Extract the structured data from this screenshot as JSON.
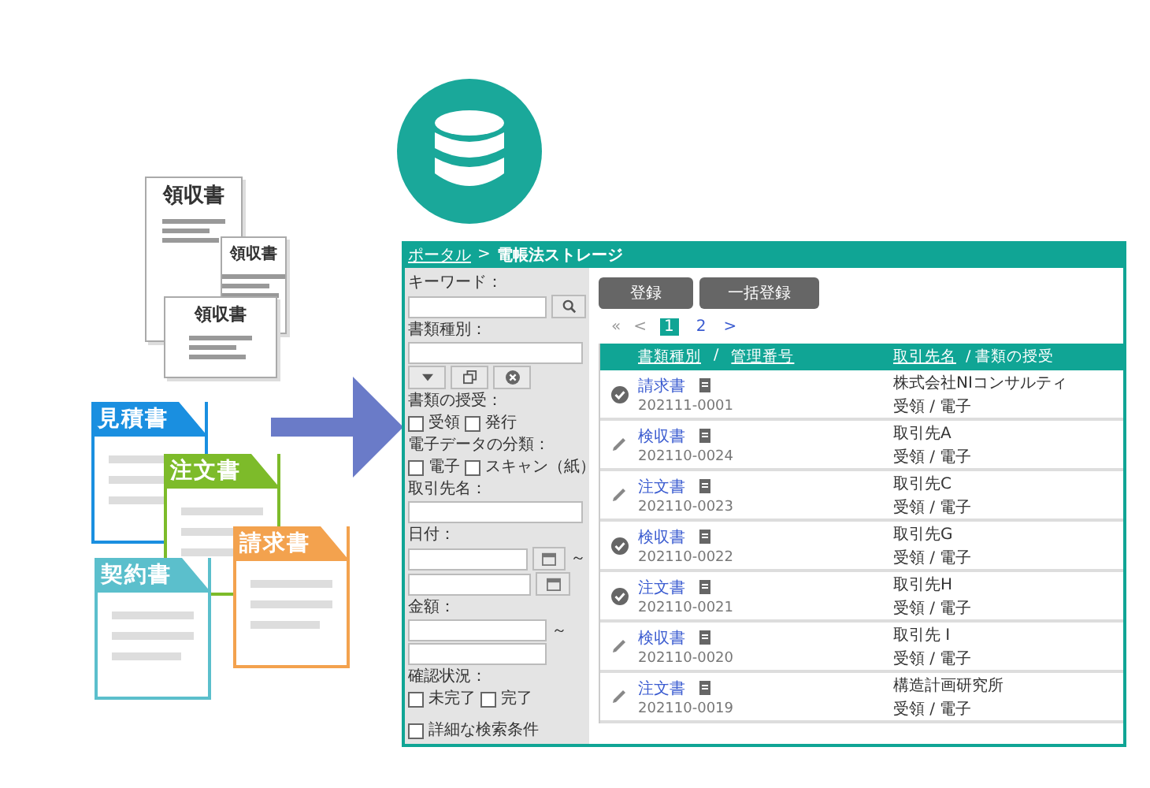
{
  "illustration": {
    "receipts": [
      "領収書",
      "領収書",
      "領収書"
    ],
    "documents": [
      {
        "title": "見積書",
        "color": "#1a8fe0"
      },
      {
        "title": "注文書",
        "color": "#7dbb2a"
      },
      {
        "title": "契約書",
        "color": "#5bbfcc"
      },
      {
        "title": "請求書",
        "color": "#f3a24e"
      }
    ]
  },
  "app": {
    "breadcrumb": {
      "link": "ポータル",
      "separator": ">",
      "current": "電帳法ストレージ"
    },
    "search_panel": {
      "keyword_label": "キーワード：",
      "type_label": "書類種別：",
      "exchange_label": "書類の授受：",
      "exchange_options": [
        {
          "label": "受領",
          "checked": false
        },
        {
          "label": "発行",
          "checked": false
        }
      ],
      "data_label": "電子データの分類：",
      "data_options": [
        {
          "label": "電子",
          "checked": false
        },
        {
          "label": "スキャン（紙）",
          "checked": false
        }
      ],
      "partner_label": "取引先名：",
      "date_label": "日付：",
      "date_separator": "～",
      "amount_label": "金額：",
      "amount_separator": "～",
      "status_label": "確認状況：",
      "status_options": [
        {
          "label": "未完了",
          "checked": false
        },
        {
          "label": "完了",
          "checked": false
        }
      ],
      "detail_option": {
        "label": "詳細な検索条件",
        "checked": false
      }
    },
    "buttons": [
      "登録",
      "一括登録"
    ],
    "pagination": {
      "first": "«",
      "prev": "<",
      "next": ">",
      "pages": [
        {
          "label": "1",
          "selected": true
        },
        {
          "label": "2",
          "selected": false
        }
      ]
    },
    "table": {
      "columns": [
        {
          "label": "書類種別"
        },
        {
          "label": "管理番号"
        },
        {
          "label": "取引先名"
        },
        {
          "label": "/ 書類の授受"
        }
      ],
      "separator": "/",
      "rows": [
        {
          "kind": "check",
          "type": "請求書",
          "number": "202111-0001",
          "partner": "株式会社NIコンサルティ",
          "exchange": "受領 / 電子"
        },
        {
          "kind": "pencil",
          "type": "検収書",
          "number": "202110-0024",
          "partner": "取引先A",
          "exchange": "受領 / 電子"
        },
        {
          "kind": "pencil",
          "type": "注文書",
          "number": "202110-0023",
          "partner": "取引先C",
          "exchange": "受領 / 電子"
        },
        {
          "kind": "check",
          "type": "検収書",
          "number": "202110-0022",
          "partner": "取引先G",
          "exchange": "受領 / 電子"
        },
        {
          "kind": "check",
          "type": "注文書",
          "number": "202110-0021",
          "partner": "取引先H",
          "exchange": "受領 / 電子"
        },
        {
          "kind": "pencil",
          "type": "検収書",
          "number": "202110-0020",
          "partner": "取引先 I",
          "exchange": "受領 / 電子"
        },
        {
          "kind": "pencil",
          "type": "注文書",
          "number": "202110-0019",
          "partner": "構造計画研究所",
          "exchange": "受領 / 電子"
        }
      ]
    }
  }
}
